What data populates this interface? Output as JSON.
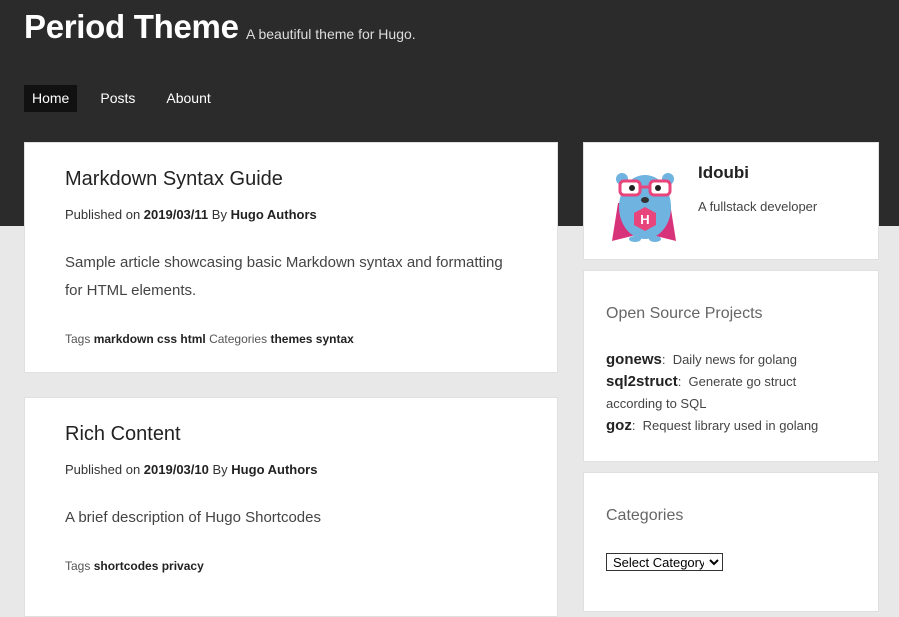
{
  "site": {
    "title": "Period Theme",
    "description": "A beautiful theme for Hugo."
  },
  "nav": {
    "items": [
      {
        "label": "Home",
        "active": true
      },
      {
        "label": "Posts",
        "active": false
      },
      {
        "label": "Abount",
        "active": false
      }
    ]
  },
  "posts": [
    {
      "title": "Markdown Syntax Guide",
      "published_prefix": "Published on",
      "date": "2019/03/11",
      "by_prefix": "By",
      "author": "Hugo Authors",
      "summary": "Sample article showcasing basic Markdown syntax and formatting for HTML elements.",
      "tags_label": "Tags",
      "tags": "markdown css html",
      "categories_label": "Categories",
      "categories": "themes syntax"
    },
    {
      "title": "Rich Content",
      "published_prefix": "Published on",
      "date": "2019/03/10",
      "by_prefix": "By",
      "author": "Hugo Authors",
      "summary": "A brief description of Hugo Shortcodes",
      "tags_label": "Tags",
      "tags": "shortcodes privacy"
    }
  ],
  "profile": {
    "name": "Idoubi",
    "bio": "A fullstack developer",
    "avatar_icon": "hugo-gopher-avatar-icon",
    "avatar_letter": "H"
  },
  "projects": {
    "title": "Open Source Projects",
    "items": [
      {
        "name": "gonews",
        "desc": "Daily news for golang"
      },
      {
        "name": "sql2struct",
        "desc": "Generate go struct according to SQL"
      },
      {
        "name": "goz",
        "desc": "Request library used in golang"
      }
    ]
  },
  "categories": {
    "title": "Categories",
    "selected": "Select Category"
  },
  "colors": {
    "header_bg": "#2b2b2b",
    "page_bg": "#e8e8e8",
    "nav_active_bg": "#111111",
    "avatar_body": "#6fb3e0",
    "avatar_glasses": "#e8457d"
  }
}
